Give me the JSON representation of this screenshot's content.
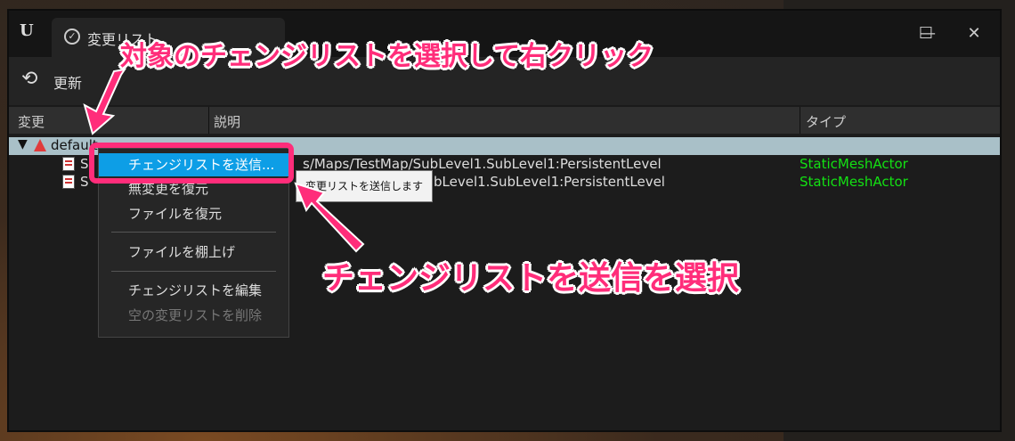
{
  "window": {
    "tab_title": "変更リスト",
    "minimize": "—",
    "maximize": "☐",
    "close": "✕"
  },
  "toolbar": {
    "refresh_label": "更新"
  },
  "columns": {
    "change": "変更",
    "description": "説明",
    "type": "タイプ"
  },
  "changelist": {
    "group": "default",
    "rows": [
      {
        "name": "S",
        "path": "s/Maps/TestMap/SubLevel1.SubLevel1:PersistentLevel",
        "type": "StaticMeshActor"
      },
      {
        "name": "S",
        "path": "bLevel1.SubLevel1:PersistentLevel",
        "type": "StaticMeshActor"
      }
    ]
  },
  "context_menu": {
    "items": [
      {
        "label": "チェンジリストを送信..."
      },
      {
        "label": "無変更を復元"
      },
      {
        "label": "ファイルを復元"
      },
      {
        "label": "ファイルを棚上げ"
      },
      {
        "label": "チェンジリストを編集"
      },
      {
        "label": "空の変更リストを削除"
      }
    ]
  },
  "tooltip": {
    "text": "変更リストを送信します"
  },
  "annotations": {
    "top": "対象のチェンジリストを選択して右クリック",
    "bottom": "チェンジリストを送信を選択"
  },
  "colors": {
    "accent_pink": "#ff2d7a",
    "menu_highlight": "#0d9ee6",
    "type_green": "#13e013",
    "selected_row": "#a9c0c8"
  }
}
